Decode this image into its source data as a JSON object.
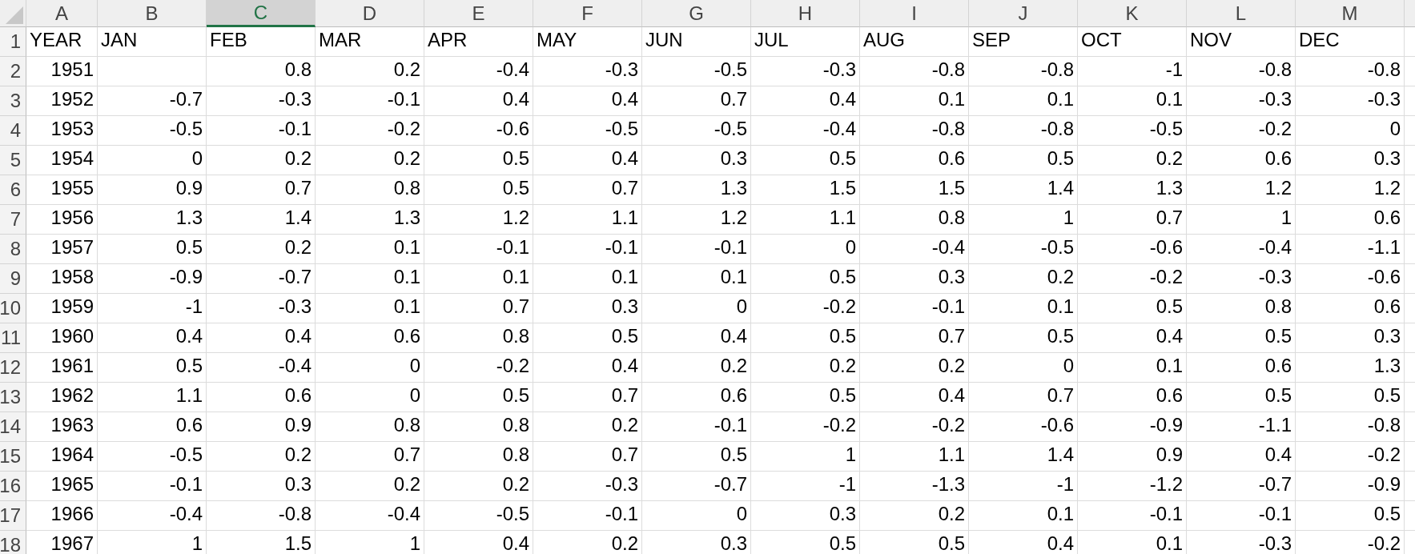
{
  "column_headers": [
    {
      "label": "A",
      "selected": false
    },
    {
      "label": "B",
      "selected": false
    },
    {
      "label": "C",
      "selected": true
    },
    {
      "label": "D",
      "selected": false
    },
    {
      "label": "E",
      "selected": false
    },
    {
      "label": "F",
      "selected": false
    },
    {
      "label": "G",
      "selected": false
    },
    {
      "label": "H",
      "selected": false
    },
    {
      "label": "I",
      "selected": false
    },
    {
      "label": "J",
      "selected": false
    },
    {
      "label": "K",
      "selected": false
    },
    {
      "label": "L",
      "selected": false
    },
    {
      "label": "M",
      "selected": false
    }
  ],
  "rows": [
    {
      "number": "1",
      "kind": "text",
      "cells": [
        "YEAR",
        "JAN",
        "FEB",
        "MAR",
        "APR",
        "MAY",
        "JUN",
        "JUL",
        "AUG",
        "SEP",
        "OCT",
        "NOV",
        "DEC"
      ]
    },
    {
      "number": "2",
      "kind": "number",
      "cells": [
        "1951",
        null,
        "0.8",
        "0.2",
        "-0.4",
        "-0.3",
        "-0.5",
        "-0.3",
        "-0.8",
        "-0.8",
        "-1",
        "-0.8",
        "-0.8"
      ]
    },
    {
      "number": "3",
      "kind": "number",
      "cells": [
        "1952",
        "-0.7",
        "-0.3",
        "-0.1",
        "0.4",
        "0.4",
        "0.7",
        "0.4",
        "0.1",
        "0.1",
        "0.1",
        "-0.3",
        "-0.3"
      ]
    },
    {
      "number": "4",
      "kind": "number",
      "cells": [
        "1953",
        "-0.5",
        "-0.1",
        "-0.2",
        "-0.6",
        "-0.5",
        "-0.5",
        "-0.4",
        "-0.8",
        "-0.8",
        "-0.5",
        "-0.2",
        "0"
      ]
    },
    {
      "number": "5",
      "kind": "number",
      "cells": [
        "1954",
        "0",
        "0.2",
        "0.2",
        "0.5",
        "0.4",
        "0.3",
        "0.5",
        "0.6",
        "0.5",
        "0.2",
        "0.6",
        "0.3"
      ]
    },
    {
      "number": "6",
      "kind": "number",
      "cells": [
        "1955",
        "0.9",
        "0.7",
        "0.8",
        "0.5",
        "0.7",
        "1.3",
        "1.5",
        "1.5",
        "1.4",
        "1.3",
        "1.2",
        "1.2"
      ]
    },
    {
      "number": "7",
      "kind": "number",
      "cells": [
        "1956",
        "1.3",
        "1.4",
        "1.3",
        "1.2",
        "1.1",
        "1.2",
        "1.1",
        "0.8",
        "1",
        "0.7",
        "1",
        "0.6"
      ]
    },
    {
      "number": "8",
      "kind": "number",
      "cells": [
        "1957",
        "0.5",
        "0.2",
        "0.1",
        "-0.1",
        "-0.1",
        "-0.1",
        "0",
        "-0.4",
        "-0.5",
        "-0.6",
        "-0.4",
        "-1.1"
      ]
    },
    {
      "number": "9",
      "kind": "number",
      "cells": [
        "1958",
        "-0.9",
        "-0.7",
        "0.1",
        "0.1",
        "0.1",
        "0.1",
        "0.5",
        "0.3",
        "0.2",
        "-0.2",
        "-0.3",
        "-0.6"
      ]
    },
    {
      "number": "10",
      "kind": "number",
      "cells": [
        "1959",
        "-1",
        "-0.3",
        "0.1",
        "0.7",
        "0.3",
        "0",
        "-0.2",
        "-0.1",
        "0.1",
        "0.5",
        "0.8",
        "0.6"
      ]
    },
    {
      "number": "11",
      "kind": "number",
      "cells": [
        "1960",
        "0.4",
        "0.4",
        "0.6",
        "0.8",
        "0.5",
        "0.4",
        "0.5",
        "0.7",
        "0.5",
        "0.4",
        "0.5",
        "0.3"
      ]
    },
    {
      "number": "12",
      "kind": "number",
      "cells": [
        "1961",
        "0.5",
        "-0.4",
        "0",
        "-0.2",
        "0.4",
        "0.2",
        "0.2",
        "0.2",
        "0",
        "0.1",
        "0.6",
        "1.3"
      ]
    },
    {
      "number": "13",
      "kind": "number",
      "cells": [
        "1962",
        "1.1",
        "0.6",
        "0",
        "0.5",
        "0.7",
        "0.6",
        "0.5",
        "0.4",
        "0.7",
        "0.6",
        "0.5",
        "0.5"
      ]
    },
    {
      "number": "14",
      "kind": "number",
      "cells": [
        "1963",
        "0.6",
        "0.9",
        "0.8",
        "0.8",
        "0.2",
        "-0.1",
        "-0.2",
        "-0.2",
        "-0.6",
        "-0.9",
        "-1.1",
        "-0.8"
      ]
    },
    {
      "number": "15",
      "kind": "number",
      "cells": [
        "1964",
        "-0.5",
        "0.2",
        "0.7",
        "0.8",
        "0.7",
        "0.5",
        "1",
        "1.1",
        "1.4",
        "0.9",
        "0.4",
        "-0.2"
      ]
    },
    {
      "number": "16",
      "kind": "number",
      "cells": [
        "1965",
        "-0.1",
        "0.3",
        "0.2",
        "0.2",
        "-0.3",
        "-0.7",
        "-1",
        "-1.3",
        "-1",
        "-1.2",
        "-0.7",
        "-0.9"
      ]
    },
    {
      "number": "17",
      "kind": "number",
      "cells": [
        "1966",
        "-0.4",
        "-0.8",
        "-0.4",
        "-0.5",
        "-0.1",
        "0",
        "0.3",
        "0.2",
        "0.1",
        "-0.1",
        "-0.1",
        "0.5"
      ]
    },
    {
      "number": "18",
      "kind": "number",
      "cells": [
        "1967",
        "1",
        "1.5",
        "1",
        "0.4",
        "0.2",
        "0.3",
        "0.5",
        "0.5",
        "0.4",
        "0.1",
        "-0.3",
        "-0.2"
      ]
    }
  ]
}
